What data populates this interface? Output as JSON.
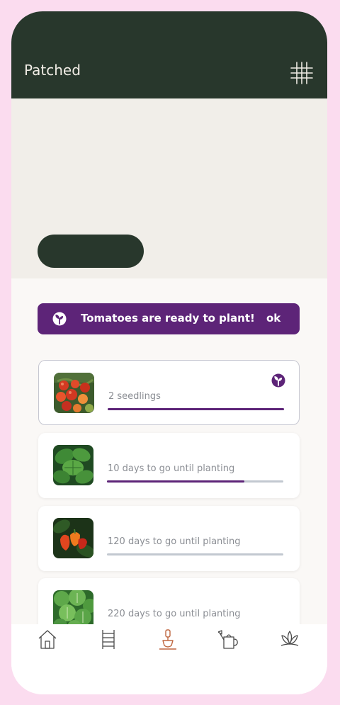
{
  "app": {
    "title": "Patched",
    "grid_icon": "grid-icon"
  },
  "header": {
    "title": ""
  },
  "filter": {
    "chip_label": ""
  },
  "banner": {
    "icon": "sprout-icon",
    "message": "Tomatoes are ready to plant!",
    "action": "ok"
  },
  "plants": [
    {
      "name": "",
      "detail": "2 seedlings",
      "progress": 1.0,
      "ready": true,
      "selected": true,
      "thumbnail": "tomatoes-photo",
      "status_icon": "sprout-icon"
    },
    {
      "name": "",
      "detail": "10 days to go until planting",
      "progress": 0.78,
      "ready": false,
      "selected": false,
      "thumbnail": "basil-photo"
    },
    {
      "name": "",
      "detail": "120 days to go until planting",
      "progress": 0.0,
      "ready": false,
      "selected": false,
      "thumbnail": "chilli-peppers-photo"
    },
    {
      "name": "",
      "detail": "220 days to go until planting",
      "progress": 0.02,
      "ready": false,
      "selected": false,
      "thumbnail": "lettuce-photo"
    }
  ],
  "nav": {
    "active": "Planting",
    "items": [
      {
        "label": "",
        "icon": "home-icon"
      },
      {
        "label": "",
        "icon": "ladder-icon"
      },
      {
        "label": "",
        "icon": "trowel-icon"
      },
      {
        "label": "",
        "icon": "watering-can-icon"
      },
      {
        "label": "",
        "icon": "lotus-icon"
      }
    ]
  },
  "colors": {
    "header_bg": "#28372c",
    "accent_purple": "#5d2478",
    "accent_terracotta": "#bf6740",
    "hero_bg": "#f1eee9",
    "frame_pink": "#fbdcef"
  }
}
